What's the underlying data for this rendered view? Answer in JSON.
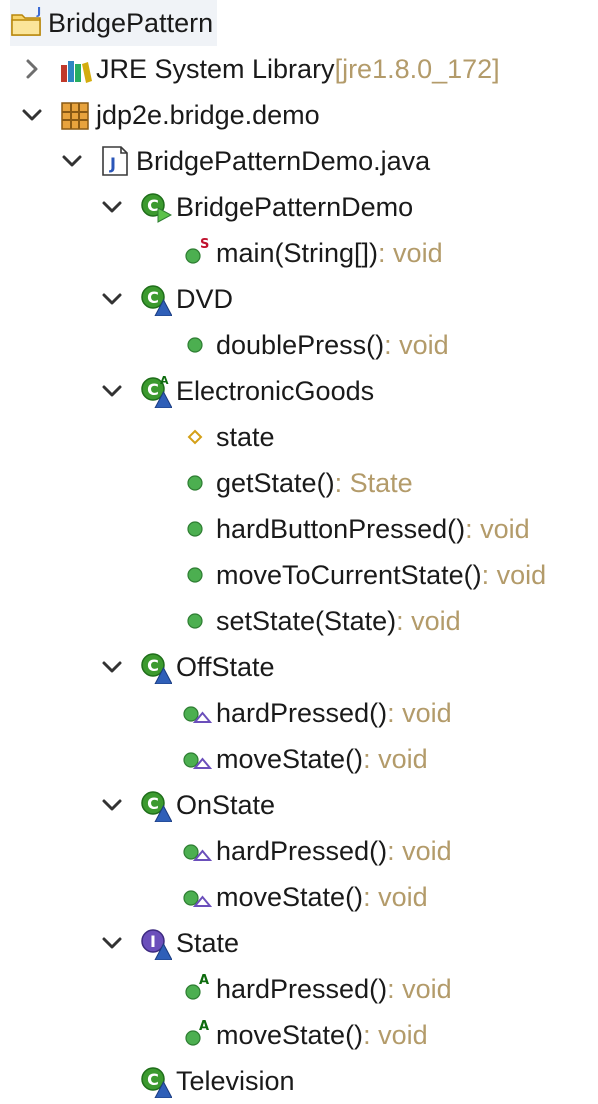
{
  "project": {
    "label": "BridgePattern",
    "icon": "project-folder-icon"
  },
  "jre": {
    "label": "JRE System Library",
    "suffix": "[jre1.8.0_172]",
    "icon": "library-icon",
    "expanded": false
  },
  "package": {
    "label": "jdp2e.bridge.demo",
    "icon": "package-icon",
    "expanded": true
  },
  "file": {
    "label": "BridgePatternDemo.java",
    "icon": "java-file-icon",
    "expanded": true
  },
  "classes": [
    {
      "label": "BridgePatternDemo",
      "icon": "runnable-class-icon",
      "expanded": true,
      "members": [
        {
          "label": "main(String[])",
          "suffix": ": void",
          "icon": "public-static-method-icon"
        }
      ]
    },
    {
      "label": "DVD",
      "icon": "class-icon",
      "expanded": true,
      "members": [
        {
          "label": "doublePress()",
          "suffix": ": void",
          "icon": "public-method-icon"
        }
      ]
    },
    {
      "label": "ElectronicGoods",
      "icon": "abstract-class-icon",
      "expanded": true,
      "members": [
        {
          "label": "state",
          "suffix": "",
          "icon": "protected-field-icon"
        },
        {
          "label": "getState()",
          "suffix": ": State",
          "icon": "public-method-icon"
        },
        {
          "label": "hardButtonPressed()",
          "suffix": ": void",
          "icon": "public-method-icon"
        },
        {
          "label": "moveToCurrentState()",
          "suffix": ": void",
          "icon": "public-method-icon"
        },
        {
          "label": "setState(State)",
          "suffix": ": void",
          "icon": "public-method-icon"
        }
      ]
    },
    {
      "label": "OffState",
      "icon": "class-icon",
      "expanded": true,
      "members": [
        {
          "label": "hardPressed()",
          "suffix": ": void",
          "icon": "implements-method-icon"
        },
        {
          "label": "moveState()",
          "suffix": ": void",
          "icon": "implements-method-icon"
        }
      ]
    },
    {
      "label": "OnState",
      "icon": "class-icon",
      "expanded": true,
      "members": [
        {
          "label": "hardPressed()",
          "suffix": ": void",
          "icon": "implements-method-icon"
        },
        {
          "label": "moveState()",
          "suffix": ": void",
          "icon": "implements-method-icon"
        }
      ]
    },
    {
      "label": "State",
      "icon": "interface-icon",
      "expanded": true,
      "members": [
        {
          "label": "hardPressed()",
          "suffix": ": void",
          "icon": "abstract-method-icon"
        },
        {
          "label": "moveState()",
          "suffix": ": void",
          "icon": "abstract-method-icon"
        }
      ]
    },
    {
      "label": "Television",
      "icon": "class-icon",
      "expanded": null,
      "members": []
    }
  ],
  "colors": {
    "text": "#1a1a1a",
    "type_suffix": "#b39b6a",
    "method_green": "#4caf50",
    "class_green": "#3c9a2f",
    "triangle_blue": "#2f5fb8",
    "interface_purple": "#6b4fbb",
    "static_red": "#c0112d",
    "field_yellow": "#d4a017",
    "chevron": "#333333",
    "root_bg": "#f0f3f7"
  }
}
